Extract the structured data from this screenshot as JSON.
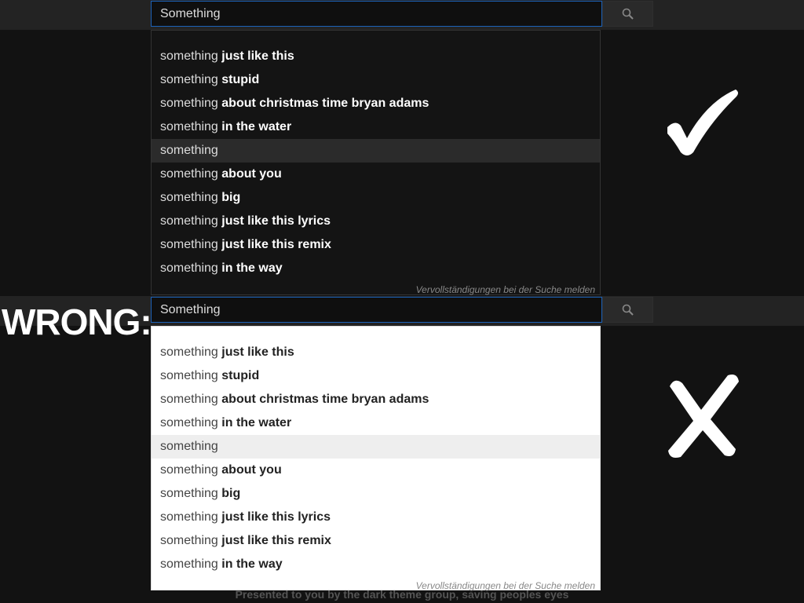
{
  "query": "Something",
  "suggestion_prefix": "something",
  "suggestions": [
    " just like this",
    " stupid",
    " about christmas time bryan adams",
    " in the water",
    "",
    " about you",
    " big",
    " just like this lyrics",
    " just like this remix",
    " in the way"
  ],
  "highlighted_index": 4,
  "report_link": "Vervollständigungen bei der Suche melden",
  "wrong_label": "WRONG:",
  "footer": "Presented to you by the dark theme group, saving peoples eyes",
  "icons": {
    "search": "search-icon",
    "correct": "checkmark-icon",
    "incorrect": "cross-icon"
  }
}
